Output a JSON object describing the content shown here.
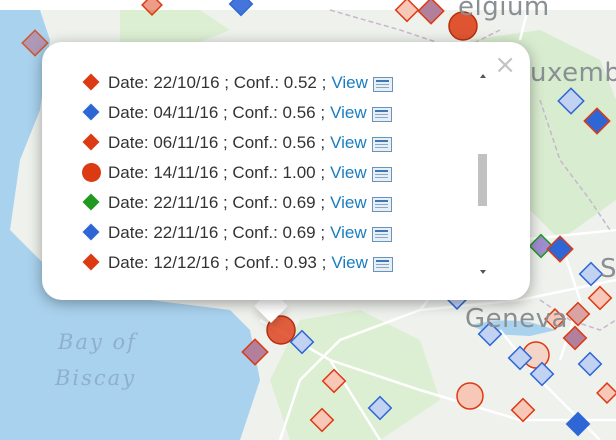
{
  "map": {
    "labels": {
      "country_top": "elgium",
      "country_right": "uxembou",
      "city": "Geneva",
      "letter_right": "S"
    },
    "sea_label": {
      "line1": "Bay of",
      "line2": "Biscay"
    },
    "colors": {
      "land": "#eef1ec",
      "forest": "#d8eccf",
      "water": "#a9d2ee",
      "road": "#ffffff",
      "border": "#c9b6cf",
      "red_marker": "#dc3a12",
      "blue_marker": "#2f66d6",
      "green_marker": "#1f9a1f"
    }
  },
  "popup": {
    "close_label": "×",
    "rows": [
      {
        "shape": "diamond",
        "color": "#dc3a12",
        "text": "Date: 22/10/16 ; Conf.: 0.52 ;",
        "link": "View"
      },
      {
        "shape": "diamond",
        "color": "#2f66d6",
        "text": "Date: 04/11/16 ; Conf.: 0.56 ;",
        "link": "View"
      },
      {
        "shape": "diamond",
        "color": "#dc3a12",
        "text": "Date: 06/11/16 ; Conf.: 0.56 ;",
        "link": "View"
      },
      {
        "shape": "circle",
        "color": "#dc3a12",
        "text": "Date: 14/11/16 ; Conf.: 1.00 ;",
        "link": "View"
      },
      {
        "shape": "diamond",
        "color": "#1f9a1f",
        "text": "Date: 22/11/16 ; Conf.: 0.69 ;",
        "link": "View"
      },
      {
        "shape": "diamond",
        "color": "#2f66d6",
        "text": "Date: 22/11/16 ; Conf.: 0.69 ;",
        "link": "View"
      },
      {
        "shape": "diamond",
        "color": "#dc3a12",
        "text": "Date: 12/12/16 ; Conf.: 0.93 ;",
        "link": "View"
      },
      {
        "shape": "diamond",
        "color": "#2f66d6",
        "text": "",
        "link": ""
      }
    ]
  }
}
